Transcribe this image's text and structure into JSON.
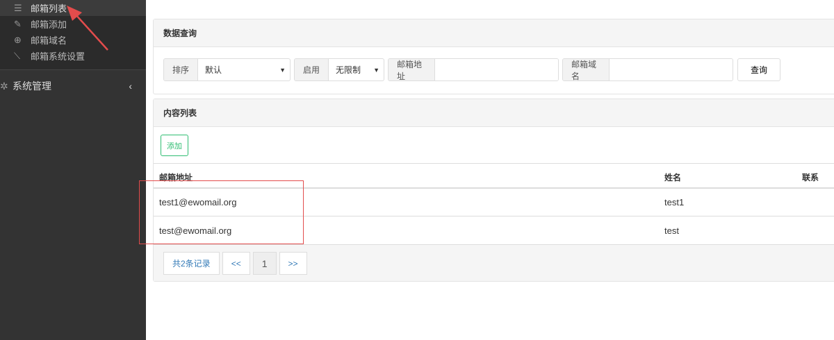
{
  "sidebar": {
    "items": [
      {
        "label": "邮箱列表",
        "icon": "list-icon"
      },
      {
        "label": "邮箱添加",
        "icon": "pencil-icon"
      },
      {
        "label": "邮箱域名",
        "icon": "globe-icon"
      },
      {
        "label": "邮箱系统设置",
        "icon": "wrench-icon"
      }
    ],
    "group": {
      "label": "系统管理",
      "icon": "gear-icon"
    }
  },
  "query": {
    "title": "数据查询",
    "sort_label": "排序",
    "sort_value": "默认",
    "enable_label": "启用",
    "enable_value": "无限制",
    "email_label": "邮箱地址",
    "email_value": "",
    "domain_label": "邮箱域名",
    "domain_value": "",
    "search_button": "查询"
  },
  "list": {
    "title": "内容列表",
    "add_button": "添加",
    "columns": [
      "邮箱地址",
      "姓名",
      "联系"
    ],
    "rows": [
      {
        "email": "test1@ewomail.org",
        "name": "test1"
      },
      {
        "email": "test@ewomail.org",
        "name": "test"
      }
    ]
  },
  "pager": {
    "total": "共2条记录",
    "prev": "<<",
    "current": "1",
    "next": ">>"
  },
  "colors": {
    "accent": "#2ebd71",
    "annotation": "#e34c4c"
  }
}
